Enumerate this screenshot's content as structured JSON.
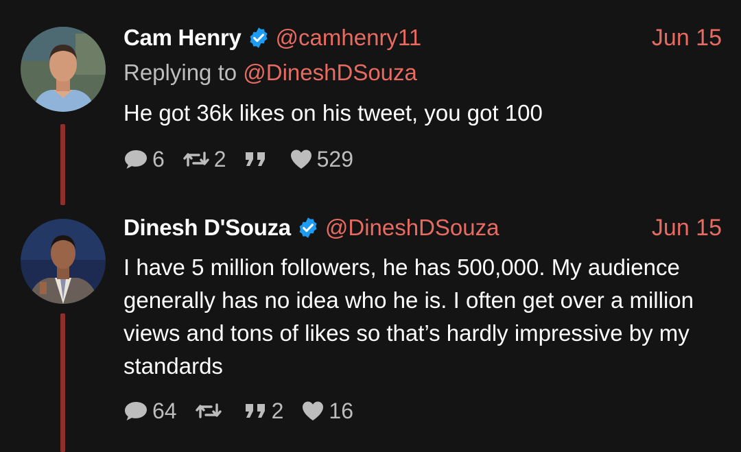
{
  "tweets": [
    {
      "name": "Cam Henry",
      "handle": "@camhenry11",
      "date": "Jun 15",
      "reply_prefix": "Replying to ",
      "reply_mention": "@DineshDSouza",
      "text": "He got 36k likes on his tweet, you got 100",
      "replies": "6",
      "retweets": "2",
      "quotes": "",
      "likes": "529",
      "verified": true
    },
    {
      "name": "Dinesh D'Souza",
      "handle": "@DineshDSouza",
      "date": "Jun 15",
      "text": "I have 5 million followers, he has 500,000. My audience generally has no idea who he is. I often get over a million views and tons of likes so that’s hardly impressive by my standards",
      "replies": "64",
      "retweets": "",
      "quotes": "2",
      "likes": "16",
      "verified": true
    }
  ],
  "colors": {
    "background": "#141414",
    "accent": "#e86b62",
    "thread_line": "#8e2f2c",
    "verified": "#1d9bf0",
    "secondary_text": "#bdbdbd"
  },
  "icons": [
    "reply-icon",
    "retweet-icon",
    "quote-icon",
    "like-icon",
    "verified-badge-icon"
  ]
}
